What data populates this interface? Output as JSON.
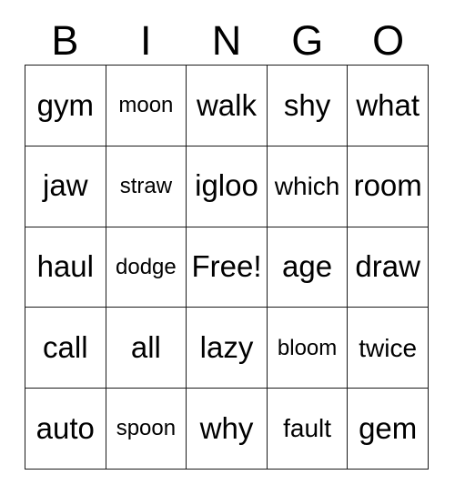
{
  "card": {
    "title": "BINGO",
    "header_letters": [
      "B",
      "I",
      "N",
      "G",
      "O"
    ],
    "free_space_label": "Free!",
    "colors": {
      "background": "#ffffff",
      "border": "#1a1a1a",
      "text": "#000000"
    },
    "rows": [
      [
        {
          "word": "gym",
          "size": "lg"
        },
        {
          "word": "moon",
          "size": "sm"
        },
        {
          "word": "walk",
          "size": "lg"
        },
        {
          "word": "shy",
          "size": "lg"
        },
        {
          "word": "what",
          "size": "lg"
        }
      ],
      [
        {
          "word": "jaw",
          "size": "lg"
        },
        {
          "word": "straw",
          "size": "sm"
        },
        {
          "word": "igloo",
          "size": "lg"
        },
        {
          "word": "which",
          "size": "md"
        },
        {
          "word": "room",
          "size": "lg"
        }
      ],
      [
        {
          "word": "haul",
          "size": "lg"
        },
        {
          "word": "dodge",
          "size": "sm"
        },
        {
          "word": "Free!",
          "size": "lg"
        },
        {
          "word": "age",
          "size": "lg"
        },
        {
          "word": "draw",
          "size": "lg"
        }
      ],
      [
        {
          "word": "call",
          "size": "lg"
        },
        {
          "word": "all",
          "size": "lg"
        },
        {
          "word": "lazy",
          "size": "lg"
        },
        {
          "word": "bloom",
          "size": "sm"
        },
        {
          "word": "twice",
          "size": "md"
        }
      ],
      [
        {
          "word": "auto",
          "size": "lg"
        },
        {
          "word": "spoon",
          "size": "sm"
        },
        {
          "word": "why",
          "size": "lg"
        },
        {
          "word": "fault",
          "size": "md"
        },
        {
          "word": "gem",
          "size": "lg"
        }
      ]
    ]
  }
}
